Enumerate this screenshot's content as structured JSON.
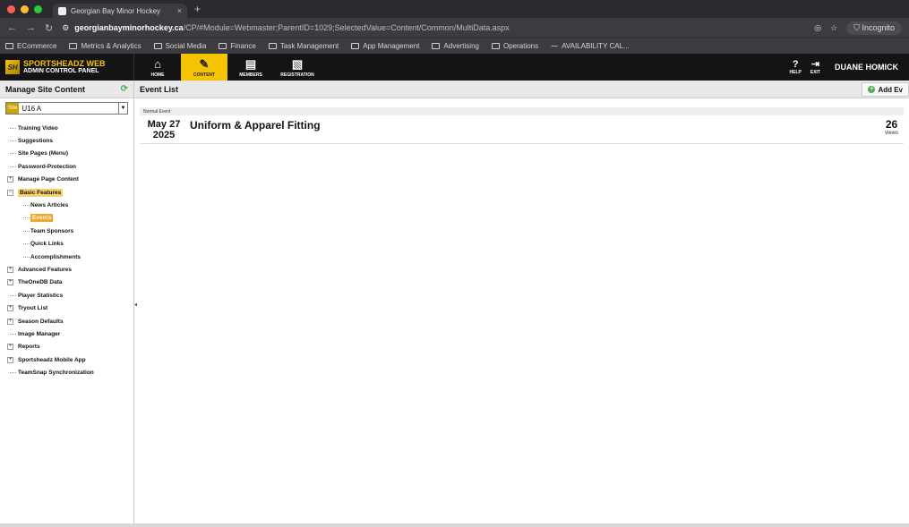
{
  "browser": {
    "tab_title": "Georgian Bay Minor Hockey",
    "tab_close": "×",
    "new_tab": "+",
    "url_domain": "georgianbayminorhockey.ca",
    "url_path": "/CP/#Module=Webmaster;ParentID=1029;SelectedValue=Content/Common/MultiData.aspx",
    "incognito_label": "Incognito",
    "bookmarks": [
      "ECommerce",
      "Metrics & Analytics",
      "Social Media",
      "Finance",
      "Task Management",
      "App Management",
      "Advertising",
      "Operations",
      "AVAILABILITY CAL..."
    ]
  },
  "admin": {
    "brand_line1": "SPORTSHEADZ WEB",
    "brand_line2": "ADMIN CONTROL PANEL",
    "brand_logo": "SH",
    "nav": [
      {
        "label": "HOME",
        "icon": "home-icon"
      },
      {
        "label": "CONTENT",
        "icon": "pencil-icon"
      },
      {
        "label": "MEMBERS",
        "icon": "clipboard-icon"
      },
      {
        "label": "REGISTRATION",
        "icon": "document-icon"
      }
    ],
    "help_label": "HELP",
    "exit_label": "EXIT",
    "user_name": "DUANE HOMICK"
  },
  "sidebar": {
    "title": "Manage Site Content",
    "site_label": "Site",
    "site_value": "U16 A",
    "tree": [
      {
        "label": "Training Video",
        "level": 0,
        "expandable": false
      },
      {
        "label": "Suggestions",
        "level": 0,
        "expandable": false
      },
      {
        "label": "Site Pages (Menu)",
        "level": 0,
        "expandable": false
      },
      {
        "label": "Password-Protection",
        "level": 0,
        "expandable": false
      },
      {
        "label": "Manage Page Content",
        "level": 0,
        "expandable": true
      },
      {
        "label": "Basic Features",
        "level": 0,
        "expandable": true,
        "highlight": "section"
      },
      {
        "label": "News Articles",
        "level": 1,
        "expandable": false
      },
      {
        "label": "Events",
        "level": 1,
        "expandable": false,
        "highlight": "selected"
      },
      {
        "label": "Team Sponsors",
        "level": 1,
        "expandable": false
      },
      {
        "label": "Quick Links",
        "level": 1,
        "expandable": false
      },
      {
        "label": "Accomplishments",
        "level": 1,
        "expandable": false
      },
      {
        "label": "Advanced Features",
        "level": 0,
        "expandable": true
      },
      {
        "label": "TheOneDB Data",
        "level": 0,
        "expandable": true
      },
      {
        "label": "Player Statistics",
        "level": 0,
        "expandable": false
      },
      {
        "label": "Tryout List",
        "level": 0,
        "expandable": true
      },
      {
        "label": "Season Defaults",
        "level": 0,
        "expandable": true
      },
      {
        "label": "Image Manager",
        "level": 0,
        "expandable": false
      },
      {
        "label": "Reports",
        "level": 0,
        "expandable": true
      },
      {
        "label": "Sportsheadz Mobile App",
        "level": 0,
        "expandable": true
      },
      {
        "label": "TeamSnap Synchronization",
        "level": 0,
        "expandable": false
      }
    ]
  },
  "content": {
    "title": "Event List",
    "add_label": "Add Ev",
    "event_type": "Normal Event",
    "events": [
      {
        "date_line1": "May 27",
        "date_line2": "2025",
        "title": "Uniform & Apparel Fitting",
        "views": "26",
        "views_label": "views"
      }
    ]
  },
  "colors": {
    "accent": "#f5c400",
    "header_bg": "#141414",
    "selected": "#f5a623"
  }
}
